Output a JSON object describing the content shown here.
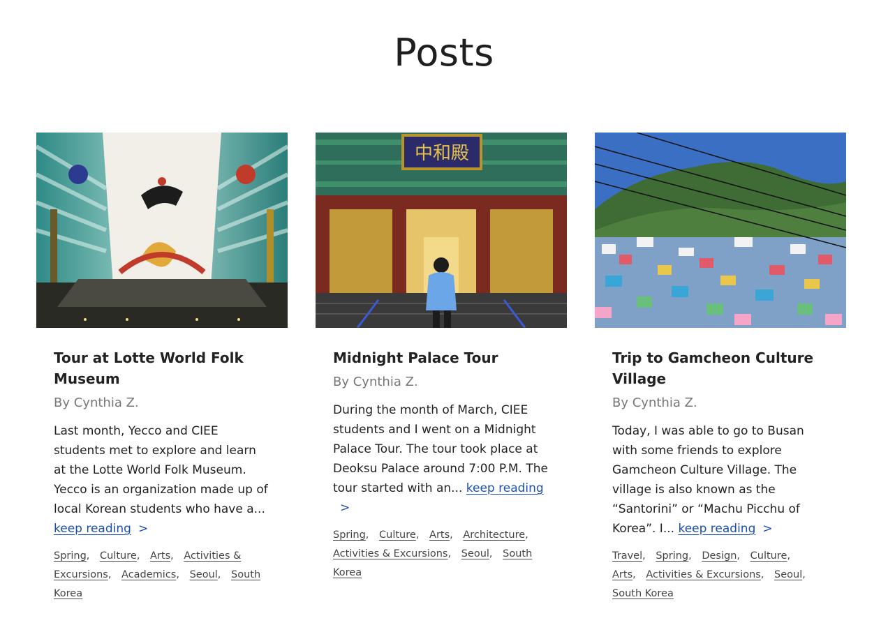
{
  "page": {
    "title": "Posts"
  },
  "posts": [
    {
      "title": "Tour at Lotte World Folk Museum",
      "author": "By Cynthia Z.",
      "excerpt": "Last month, Yecco and CIEE students met to explore and learn at the Lotte World Folk Museum. Yecco is an organization made up of local Korean students who have a...",
      "more": "keep reading",
      "chevron": ">",
      "tags": [
        "Spring",
        "Culture",
        "Arts",
        "Activities & Excursions",
        "Academics",
        "Seoul",
        "South Korea"
      ]
    },
    {
      "title": "Midnight Palace Tour",
      "author": "By Cynthia Z.",
      "excerpt": "During the month of March, CIEE students and I went on a Midnight Palace Tour. The tour took place at Deoksu Palace around 7:00 P.M. The tour started with an...",
      "more": "keep reading",
      "chevron": ">",
      "sign_text": "中和殿",
      "tags": [
        "Spring",
        "Culture",
        "Arts",
        "Architecture",
        "Activities & Excursions",
        "Seoul",
        "South Korea"
      ]
    },
    {
      "title": "Trip to Gamcheon Culture Village",
      "author": "By Cynthia Z.",
      "excerpt": "Today, I was able to go to Busan with some friends to explore Gamcheon Culture Village. The village is also known as the “Santorini” or “Machu Picchu of Korea”. I...",
      "more": "keep reading",
      "chevron": ">",
      "tags": [
        "Travel",
        "Spring",
        "Design",
        "Culture",
        "Arts",
        "Activities & Excursions",
        "Seoul",
        "South Korea"
      ]
    }
  ],
  "colors": {
    "link": "#1c4fb4",
    "author": "#777777",
    "text": "#222222"
  }
}
